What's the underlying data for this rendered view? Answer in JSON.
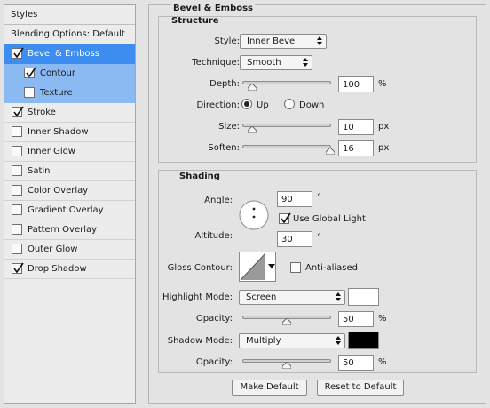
{
  "styles_panel": {
    "header": "Styles",
    "blending_options": "Blending Options: Default",
    "items": [
      {
        "label": "Bevel & Emboss",
        "checked": true
      },
      {
        "label": "Contour",
        "checked": true
      },
      {
        "label": "Texture",
        "checked": false
      },
      {
        "label": "Stroke",
        "checked": true
      },
      {
        "label": "Inner Shadow",
        "checked": false
      },
      {
        "label": "Inner Glow",
        "checked": false
      },
      {
        "label": "Satin",
        "checked": false
      },
      {
        "label": "Color Overlay",
        "checked": false
      },
      {
        "label": "Gradient Overlay",
        "checked": false
      },
      {
        "label": "Pattern Overlay",
        "checked": false
      },
      {
        "label": "Outer Glow",
        "checked": false
      },
      {
        "label": "Drop Shadow",
        "checked": true
      }
    ]
  },
  "bevel_emboss": {
    "title": "Bevel & Emboss",
    "structure": {
      "title": "Structure",
      "style_label": "Style:",
      "style_value": "Inner Bevel",
      "technique_label": "Technique:",
      "technique_value": "Smooth",
      "depth_label": "Depth:",
      "depth_value": "100",
      "depth_unit": "%",
      "direction_label": "Direction:",
      "direction_up": "Up",
      "direction_down": "Down",
      "direction_selected": "Up",
      "size_label": "Size:",
      "size_value": "10",
      "size_unit": "px",
      "soften_label": "Soften:",
      "soften_value": "16",
      "soften_unit": "px"
    },
    "shading": {
      "title": "Shading",
      "angle_label": "Angle:",
      "angle_value": "90",
      "degree_symbol": "°",
      "use_global_light_label": "Use Global Light",
      "use_global_light_checked": true,
      "altitude_label": "Altitude:",
      "altitude_value": "30",
      "gloss_contour_label": "Gloss Contour:",
      "anti_aliased_label": "Anti-aliased",
      "anti_aliased_checked": false,
      "highlight_mode_label": "Highlight Mode:",
      "highlight_mode_value": "Screen",
      "highlight_color": "#ffffff",
      "highlight_opacity_label": "Opacity:",
      "highlight_opacity_value": "50",
      "shadow_mode_label": "Shadow Mode:",
      "shadow_mode_value": "Multiply",
      "shadow_color": "#000000",
      "shadow_opacity_label": "Opacity:",
      "shadow_opacity_value": "50",
      "percent": "%"
    },
    "buttons": {
      "make_default": "Make Default",
      "reset_to_default": "Reset to Default"
    }
  },
  "colors": {
    "selection": "#3d8df0",
    "sub_selection": "#8bbaf2"
  }
}
